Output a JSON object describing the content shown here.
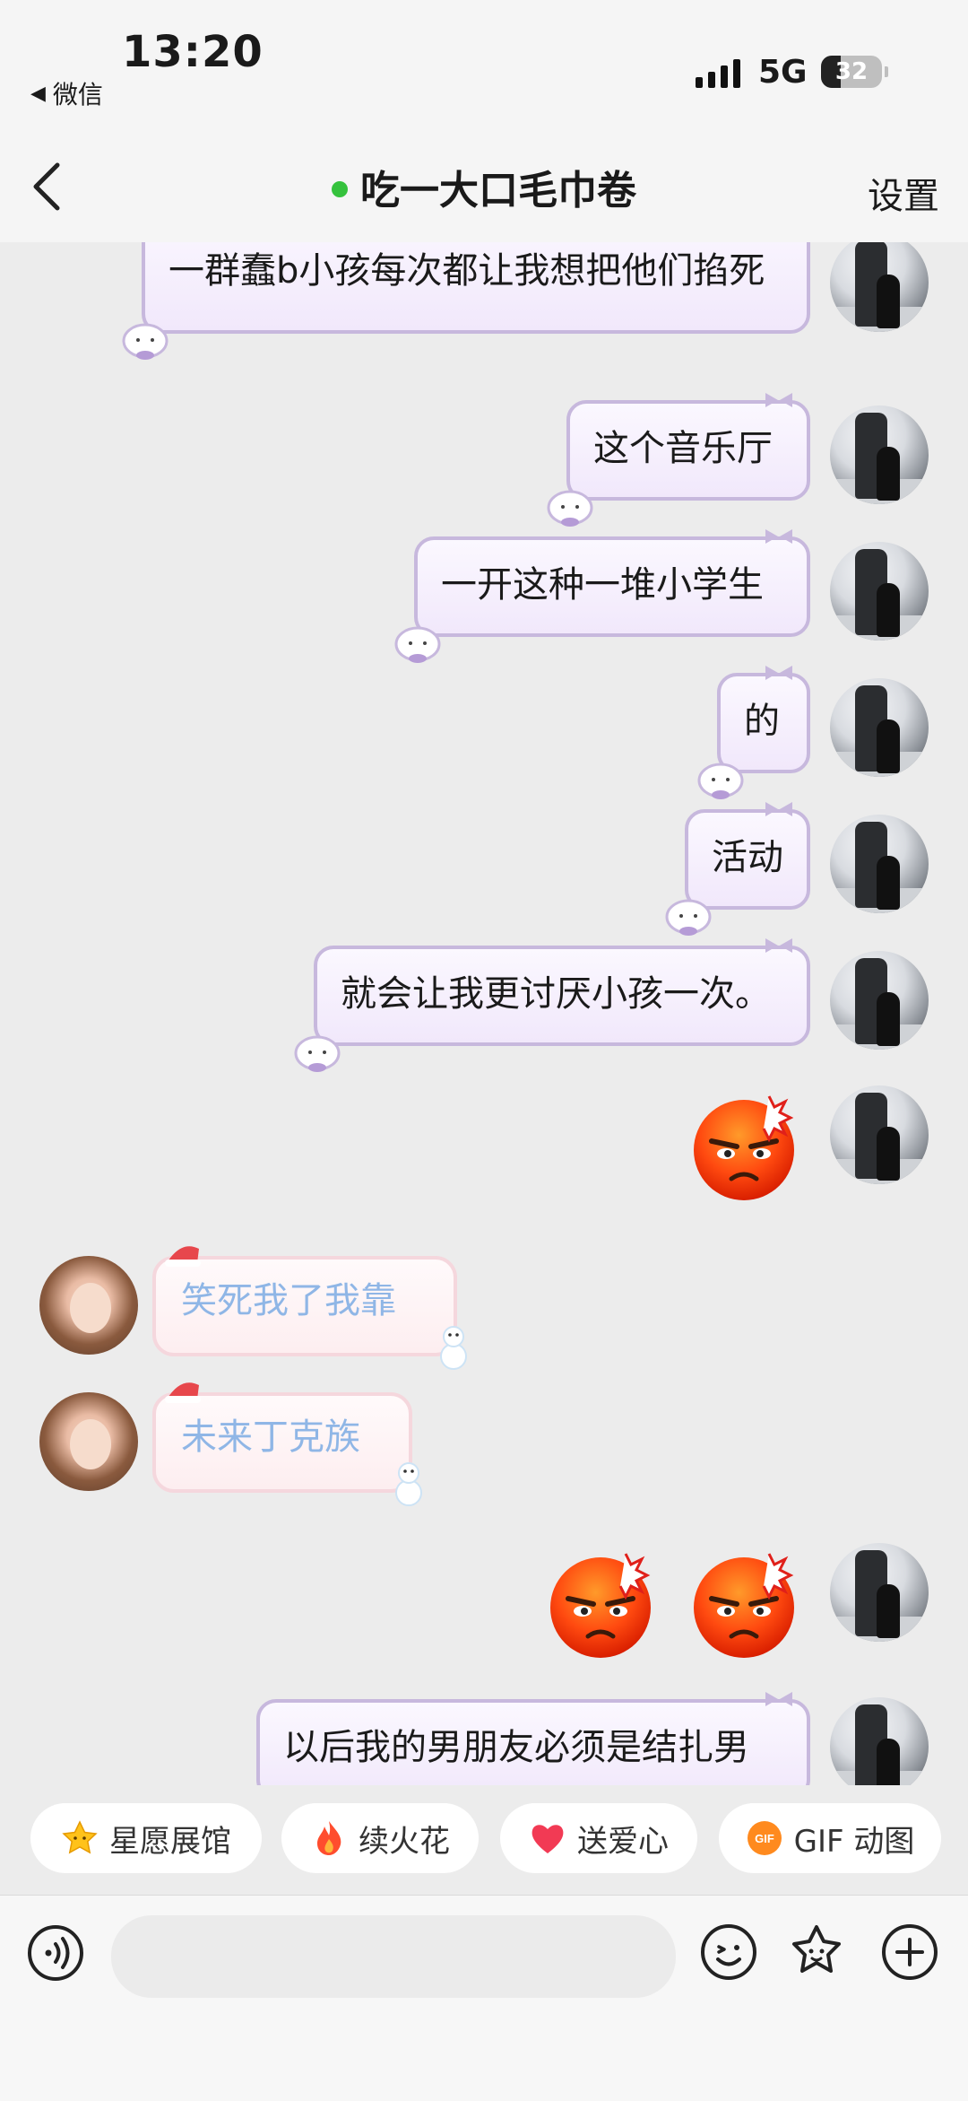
{
  "status_bar": {
    "time": "13:20",
    "back_app": "微信",
    "network": "5G",
    "battery": "32",
    "battery_level": 0.32
  },
  "header": {
    "title": "吃一大口毛巾卷",
    "settings": "设置"
  },
  "messages": [
    {
      "text": "一群蠢b小孩每次都让我想把他们掐死"
    },
    {
      "text": "这个音乐厅"
    },
    {
      "text": "一开这种一堆小学生"
    },
    {
      "text": "的"
    },
    {
      "text": "活动"
    },
    {
      "text": "就会让我更讨厌小孩一次。"
    },
    {
      "text": "笑死我了我靠"
    },
    {
      "text": "未来丁克族"
    },
    {
      "text": "以后我的男朋友必须是结扎男"
    }
  ],
  "quick_actions": [
    {
      "label": "星愿展馆",
      "icon": "star-icon"
    },
    {
      "label": "续火花",
      "icon": "flame-icon"
    },
    {
      "label": "送爱心",
      "icon": "heart-icon"
    },
    {
      "label": "GIF 动图",
      "icon": "gif-icon"
    }
  ],
  "input": {
    "placeholder": ""
  },
  "colors": {
    "online": "#35c23d",
    "my_bubble_border": "#c7b8dd",
    "her_text": "#8fb6e6"
  }
}
